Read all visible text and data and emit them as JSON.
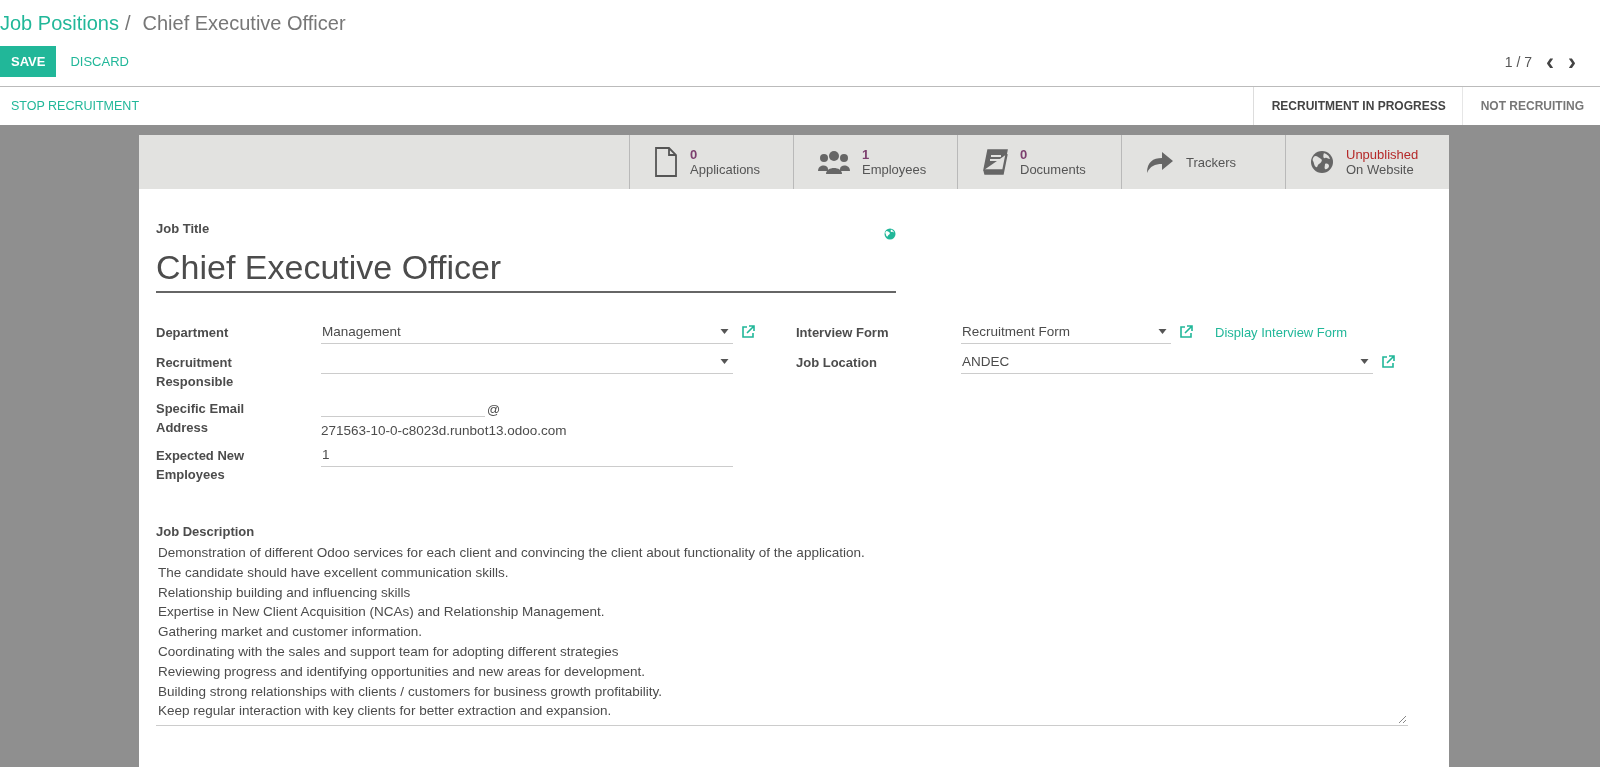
{
  "breadcrumb": {
    "parent": "Job Positions",
    "separator": "/",
    "current": "Chief Executive Officer"
  },
  "actions": {
    "save": "SAVE",
    "discard": "DISCARD"
  },
  "pager": {
    "value": "1 / 7",
    "prev": "‹",
    "next": "›"
  },
  "header_button": "STOP RECRUITMENT",
  "stages": [
    {
      "label": "RECRUITMENT IN PROGRESS",
      "selected": true
    },
    {
      "label": "NOT RECRUITING",
      "selected": false
    }
  ],
  "smart_buttons": [
    {
      "kind": "document",
      "value": "0",
      "label": "Applications"
    },
    {
      "kind": "users",
      "value": "1",
      "label": "Employees"
    },
    {
      "kind": "book",
      "value": "0",
      "label": "Documents"
    },
    {
      "kind": "share",
      "label": "Trackers"
    },
    {
      "kind": "globe",
      "value": "Unpublished",
      "label": "On Website",
      "alert": true
    }
  ],
  "job_title": {
    "label": "Job Title",
    "value": "Chief Executive Officer"
  },
  "left_fields": [
    {
      "kind": "select",
      "label": "Department",
      "value": "Management",
      "external_link": true
    },
    {
      "kind": "select",
      "label": "Recruitment Responsible",
      "external_link": false
    },
    {
      "kind": "email",
      "label": "Specific Email Address",
      "suffix": "@",
      "domain": "271563-10-0-c8023d.runbot13.odoo.com"
    },
    {
      "kind": "text",
      "label": "Expected New Employees",
      "value": "1"
    }
  ],
  "right_fields": [
    {
      "label": "Interview Form",
      "value": "Recruitment Form",
      "external_link": true,
      "link": "Display Interview Form"
    },
    {
      "label": "Job Location",
      "value": "ANDEC",
      "external_link": true
    }
  ],
  "job_description": {
    "label": "Job Description",
    "lines": [
      "Demonstration of different Odoo services for each client and convincing the client about functionality of the application.",
      "The candidate should have excellent communication skills.",
      "Relationship building and influencing skills",
      "Expertise in New Client Acquisition (NCAs) and Relationship Management.",
      "Gathering market and customer information.",
      "Coordinating with the sales and support team for adopting different strategies",
      "Reviewing progress and identifying opportunities and new areas for development.",
      "Building strong relationships with clients / customers for business growth profitability.",
      "Keep regular interaction with key clients for better extraction and expansion."
    ]
  }
}
